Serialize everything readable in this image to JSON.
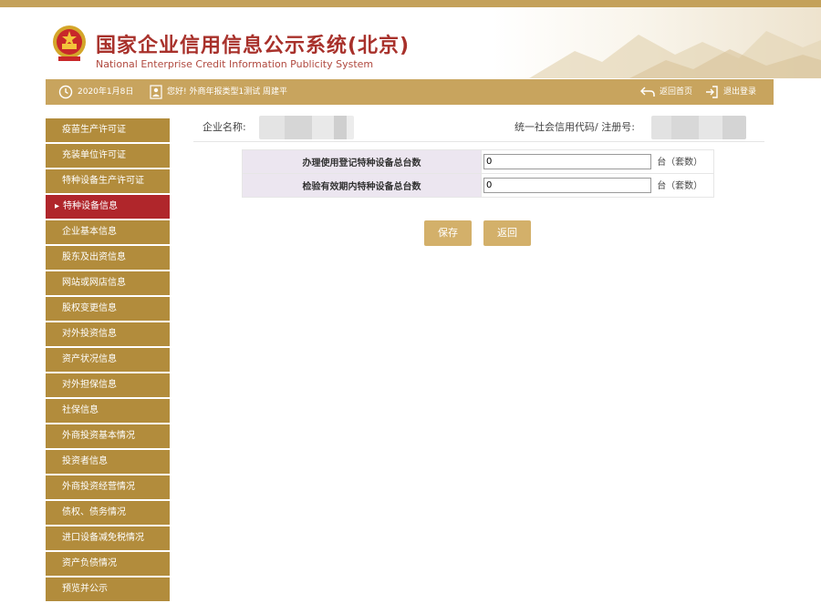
{
  "header": {
    "title_cn": "国家企业信用信息公示系统(北京)",
    "title_en": "National Enterprise Credit Information Publicity System"
  },
  "statusbar": {
    "date": "2020年1月8日",
    "greeting": "您好! 外商年报类型1测试  周建平",
    "home_label": "返回首页",
    "logout_label": "退出登录"
  },
  "sidebar": {
    "items": [
      {
        "label": "疫苗生产许可证",
        "active": false
      },
      {
        "label": "充装单位许可证",
        "active": false
      },
      {
        "label": "特种设备生产许可证",
        "active": false
      },
      {
        "label": "特种设备信息",
        "active": true
      },
      {
        "label": "企业基本信息",
        "active": false
      },
      {
        "label": "股东及出资信息",
        "active": false
      },
      {
        "label": "网站或网店信息",
        "active": false
      },
      {
        "label": "股权变更信息",
        "active": false
      },
      {
        "label": "对外投资信息",
        "active": false
      },
      {
        "label": "资产状况信息",
        "active": false
      },
      {
        "label": "对外担保信息",
        "active": false
      },
      {
        "label": "社保信息",
        "active": false
      },
      {
        "label": "外商投资基本情况",
        "active": false
      },
      {
        "label": "投资者信息",
        "active": false
      },
      {
        "label": "外商投资经营情况",
        "active": false
      },
      {
        "label": "债权、债务情况",
        "active": false
      },
      {
        "label": "进口设备减免税情况",
        "active": false
      },
      {
        "label": "资产负债情况",
        "active": false
      },
      {
        "label": "预览并公示",
        "active": false
      }
    ]
  },
  "company": {
    "name_label": "企业名称:",
    "code_label": "统一社会信用代码/ 注册号:"
  },
  "form": {
    "rows": [
      {
        "label": "办理使用登记特种设备总台数",
        "value": "0",
        "unit": "台（套数）"
      },
      {
        "label": "检验有效期内特种设备总台数",
        "value": "0",
        "unit": "台（套数）"
      }
    ]
  },
  "buttons": {
    "save": "保存",
    "back": "返回"
  },
  "colors": {
    "accent_gold": "#c8a45e",
    "sidebar_gold": "#b28c3c",
    "active_red": "#b0262b",
    "title_red": "#a8312b"
  }
}
